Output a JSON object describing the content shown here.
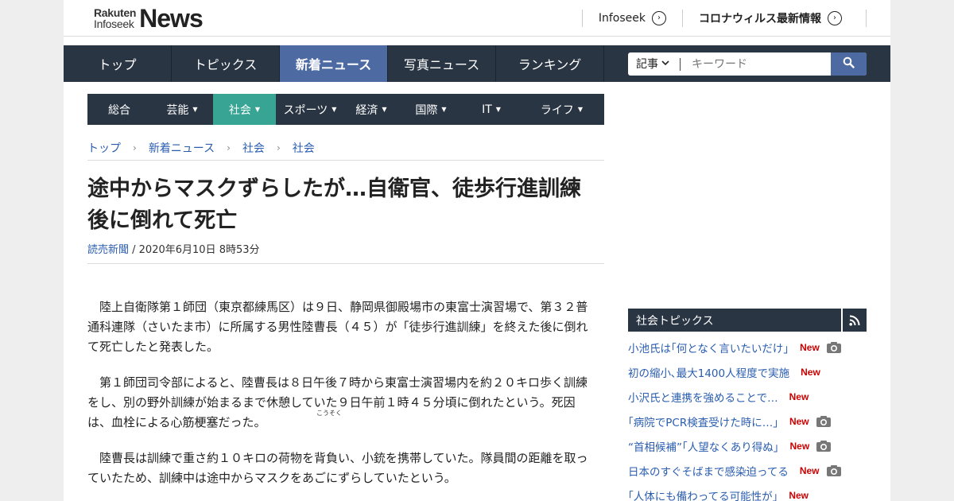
{
  "header": {
    "logo_top": "Rakuten",
    "logo_bottom": "Infoseek",
    "logo_big": "News",
    "links": [
      "Infoseek",
      "コロナウィルス最新情報"
    ]
  },
  "mainnav": {
    "items": [
      "トップ",
      "トピックス",
      "新着ニュース",
      "写真ニュース",
      "ランキング"
    ],
    "active": "新着ニュース"
  },
  "search": {
    "select_label": "記事",
    "placeholder": "キーワード"
  },
  "subnav": {
    "items": [
      "総合",
      "芸能",
      "社会",
      "スポーツ",
      "経済",
      "国際",
      "IT",
      "ライフ"
    ],
    "active": "社会"
  },
  "breadcrumb": [
    "トップ",
    "新着ニュース",
    "社会",
    "社会"
  ],
  "article": {
    "title": "途中からマスクずらしたが…自衛官、徒歩行進訓練後に倒れて死亡",
    "source": "読売新聞",
    "date": " / 2020年6月10日 8時53分",
    "ruby": "こうそく",
    "paragraphs": [
      "陸上自衛隊第１師団（東京都練馬区）は９日、静岡県御殿場市の東富士演習場で、第３２普通科連隊（さいたま市）に所属する男性陸曹長（４５）が「徒歩行進訓練」を終えた後に倒れて死亡したと発表した。",
      "第１師団司令部によると、陸曹長は８日午後７時から東富士演習場内を約２０キロ歩く訓練をし、別の野外訓練が始まるまで休憩していた９日午前１時４５分頃に倒れたという。死因は、血栓による心筋梗塞だった。",
      "陸曹長は訓練で重さ約１０キロの荷物を背負い、小銃を携帯していた。隊員間の距離を取っていたため、訓練中は途中からマスクをあごにずらしていたという。"
    ]
  },
  "sidebar": {
    "title": "社会トピックス",
    "new_label": "New",
    "topics": [
      {
        "text": "小池氏は｢何となく言いたいだけ｣",
        "camera": true
      },
      {
        "text": "初の縮小､最大1400人程度で実施",
        "camera": false
      },
      {
        "text": "小沢氏と連携を強めることで…",
        "camera": false
      },
      {
        "text": "｢病院でPCR検査受けた時に…｣",
        "camera": true
      },
      {
        "text": "“首相候補”｢人望なくあり得ぬ｣",
        "camera": true
      },
      {
        "text": "日本のすぐそばまで感染迫ってる",
        "camera": true
      },
      {
        "text": "｢人体にも備わってる可能性が｣",
        "camera": false
      }
    ]
  }
}
